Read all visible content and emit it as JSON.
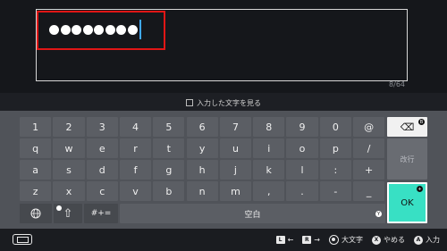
{
  "input": {
    "masked_char_count": 8,
    "char_count": "8/64"
  },
  "show_text": {
    "label": "入力した文字を見る",
    "checked": false
  },
  "keyboard": {
    "row1": [
      "1",
      "2",
      "3",
      "4",
      "5",
      "6",
      "7",
      "8",
      "9",
      "0",
      "@"
    ],
    "row2": [
      "q",
      "w",
      "e",
      "r",
      "t",
      "y",
      "u",
      "i",
      "o",
      "p",
      "/"
    ],
    "row3": [
      "a",
      "s",
      "d",
      "f",
      "g",
      "h",
      "j",
      "k",
      "l",
      ":",
      "+"
    ],
    "row4": [
      "z",
      "x",
      "c",
      "v",
      "b",
      "n",
      "m",
      ",",
      ".",
      "-",
      "_"
    ],
    "backspace_icon": "⌫",
    "backspace_badge": "B",
    "newline_label": "改行",
    "ok_label": "OK",
    "ok_badge": "+",
    "globe_icon": "globe-icon",
    "shift_icon": "⇧",
    "shift_badge": "L",
    "symbols_label": "#+=",
    "space_label": "空白",
    "space_badge": "Y"
  },
  "bottom_bar": {
    "hints": [
      {
        "button": "L",
        "label": "←"
      },
      {
        "button": "R",
        "label": "→"
      },
      {
        "button": "stick",
        "label": "大文字"
      },
      {
        "button": "X",
        "label": "やめる"
      },
      {
        "button": "A",
        "label": "入力"
      }
    ]
  },
  "colors": {
    "highlight_border": "#e01616",
    "ok_key": "#38e0c4",
    "caret": "#3fa8ff"
  }
}
